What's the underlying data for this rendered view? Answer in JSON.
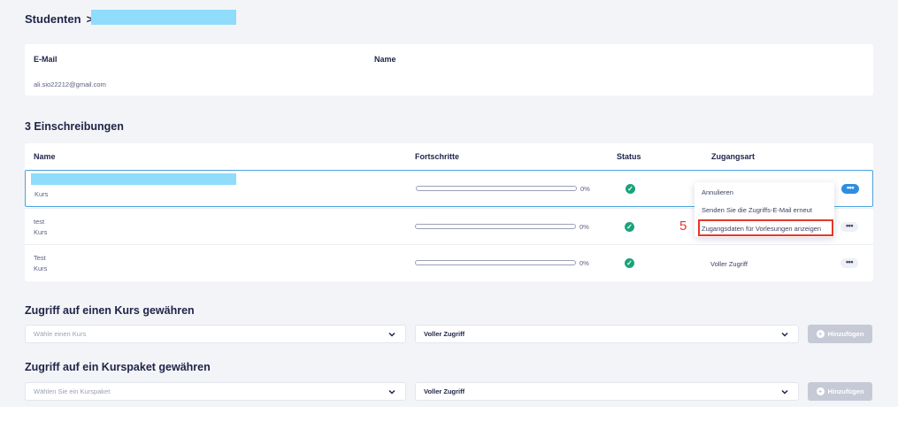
{
  "breadcrumb": {
    "root": "Studenten",
    "separator": ">"
  },
  "student": {
    "headers": {
      "email": "E-Mail",
      "name": "Name"
    },
    "email": "ali.sio22212@gmail.com",
    "name": ""
  },
  "enrollments": {
    "title": "3 Einschreibungen",
    "headers": {
      "name": "Name",
      "progress": "Fortschritte",
      "status": "Status",
      "access": "Zugangsart"
    },
    "rows": [
      {
        "name": "",
        "type": "Kurs",
        "progress": 0,
        "progress_label": "0%",
        "status": "complete",
        "access": ""
      },
      {
        "name": "test",
        "type": "Kurs",
        "progress": 0,
        "progress_label": "0%",
        "status": "complete",
        "access": ""
      },
      {
        "name": "Test",
        "type": "Kurs",
        "progress": 0,
        "progress_label": "0%",
        "status": "complete",
        "access": "Voller Zugriff"
      }
    ]
  },
  "menu": {
    "items": [
      "Annulieren",
      "Senden Sie die Zugriffs-E-Mail erneut",
      "Zugangsdaten für Vorlesungen anzeigen"
    ],
    "step_number": "5"
  },
  "grant_course": {
    "title": "Zugriff auf einen Kurs gewähren",
    "select_placeholder": "Wähle einen Kurs",
    "access_value": "Voller Zugriff",
    "button": "Hinzufügen"
  },
  "grant_bundle": {
    "title": "Zugriff auf ein Kurspaket gewähren",
    "select_placeholder": "Wählen Sie ein Kurspaket",
    "access_value": "Voller Zugriff",
    "button": "Hinzufügen"
  },
  "colors": {
    "accent": "#2d8ee0",
    "success": "#1aa37a",
    "highlight": "#e8352a",
    "redaction": "#8fdcfb"
  },
  "icons": {
    "dots": "more-horizontal-icon",
    "chevron": "chevron-down-icon",
    "plus": "plus-circle-icon",
    "check": "check-circle-icon"
  }
}
